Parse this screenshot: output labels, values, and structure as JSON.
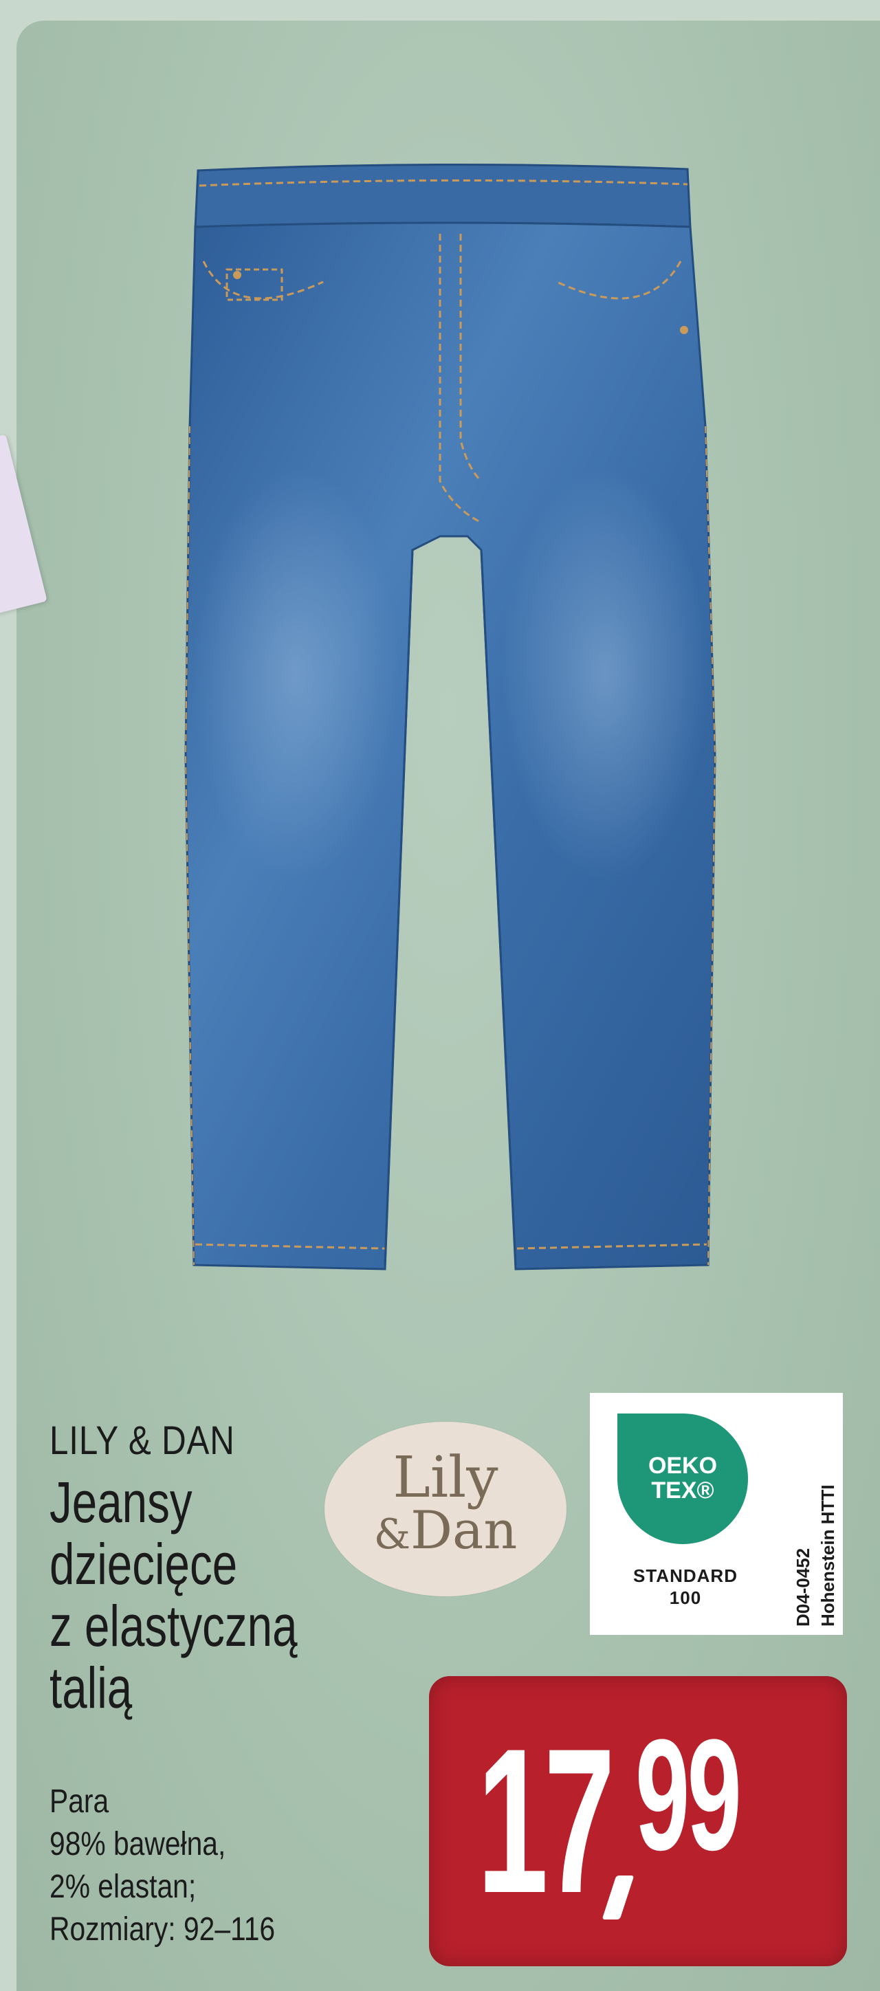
{
  "product": {
    "brand": "LILY & DAN",
    "title_lines": [
      "Jeansy",
      "dziecięce",
      "z elastyczną",
      "talią"
    ],
    "description_lines": [
      "Para",
      "98% bawełna,",
      "2% elastan;",
      "Rozmiary: 92–116"
    ]
  },
  "logo": {
    "line1": "Lily",
    "line2_amp": "&",
    "line2": "Dan",
    "icon": "lily-dan-logo"
  },
  "certificate": {
    "badge_line1": "OEKO",
    "badge_line2": "TEX®",
    "standard_line1": "STANDARD",
    "standard_line2": "100",
    "side_line1": "D04-0452",
    "side_line2": "Hohenstein HTTI"
  },
  "price": {
    "main": "17",
    "cents": "99"
  },
  "colors": {
    "background": "#a9c2b0",
    "denim": "#3b6fa8",
    "price_badge": "#b8202c",
    "oeko_green": "#1e9778"
  }
}
